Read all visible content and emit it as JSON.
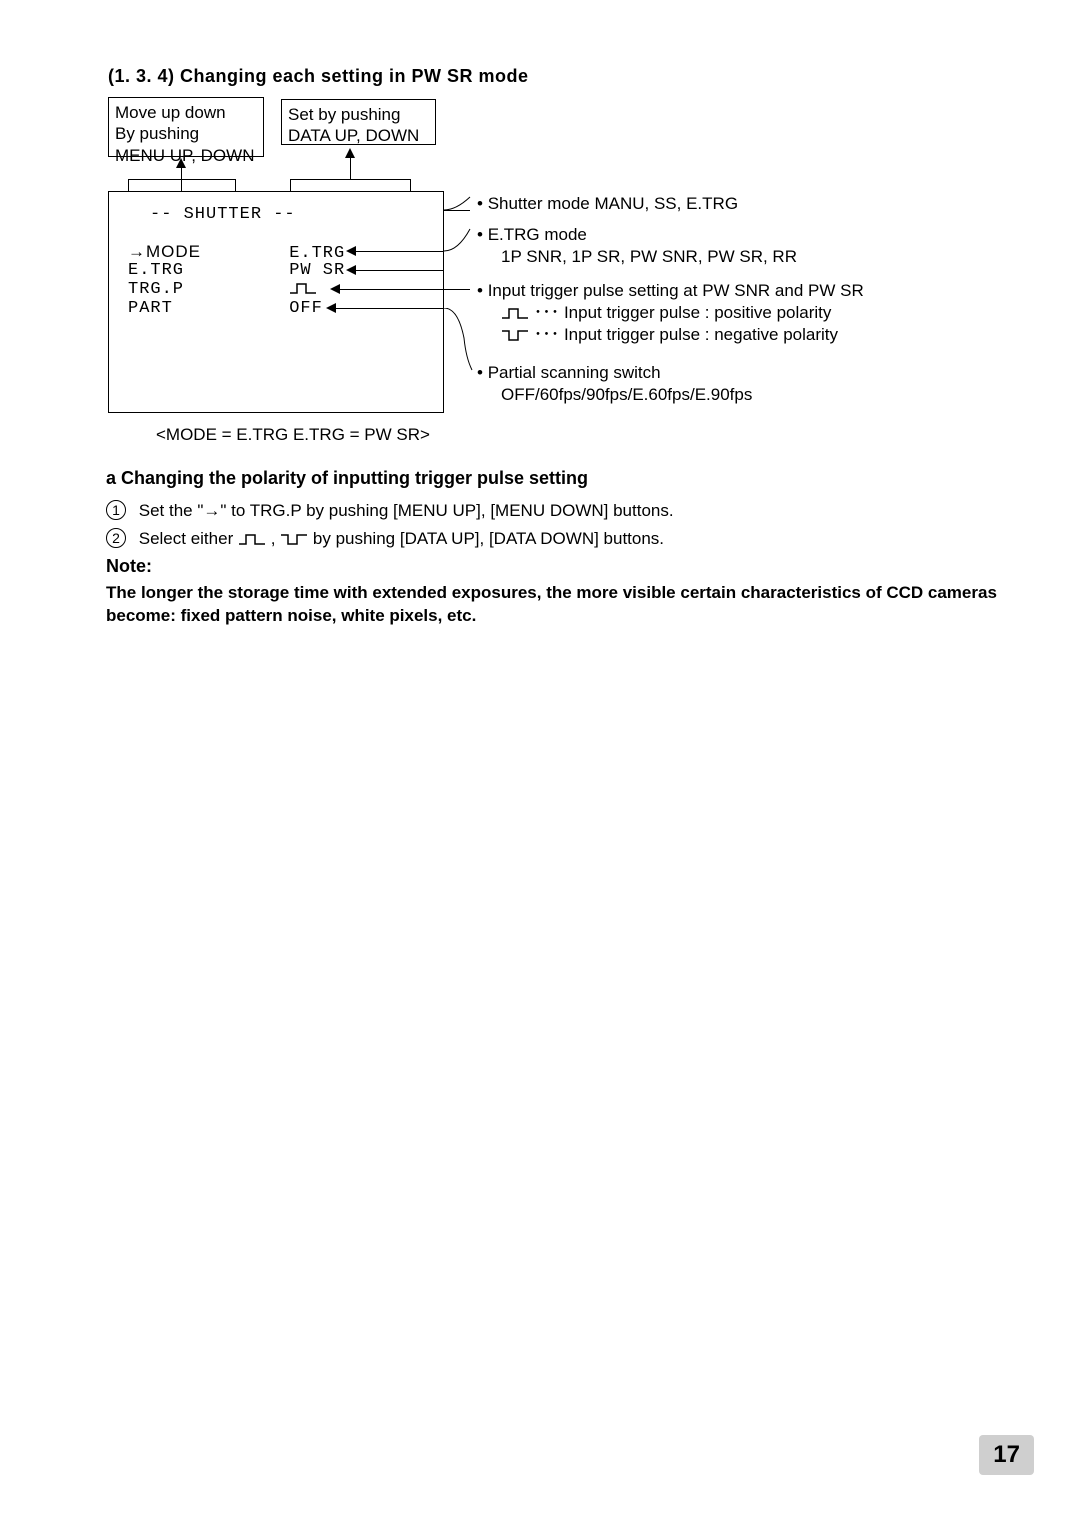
{
  "heading": "(1. 3. 4)   Changing each setting in PW SR mode",
  "box1": {
    "line1": "Move up down",
    "line2": "By pushing",
    "line3": "MENU UP, DOWN"
  },
  "box2": {
    "line1": "Set by pushing",
    "line2": "DATA UP, DOWN"
  },
  "lcd": {
    "title": "-- SHUTTER --",
    "rows": [
      {
        "label": "→MODE",
        "value": "E.TRG"
      },
      {
        "label": " E.TRG",
        "value": "PW SR"
      },
      {
        "label": " TRG.P",
        "value": ""
      },
      {
        "label": " PART",
        "value": "OFF"
      }
    ]
  },
  "desc": {
    "d1": {
      "head": "Shutter mode   MANU, SS, E.TRG"
    },
    "d2": {
      "head": "E.TRG mode",
      "sub1": "1P SNR, 1P SR, PW SNR, PW SR, RR"
    },
    "d3": {
      "head": "Input trigger pulse setting at PW SNR and PW SR",
      "sub1": " ･･･ Input trigger pulse : positive polarity",
      "sub2": " ･･･ Input trigger pulse : negative polarity"
    },
    "d4": {
      "head": "Partial scanning switch",
      "sub1": "OFF/60fps/90fps/E.60fps/E.90fps"
    }
  },
  "caption": "<MODE = E.TRG   E.TRG = PW SR>",
  "subheading": "a   Changing the polarity of inputting trigger pulse setting",
  "steps": {
    "s1_num": "1",
    "s1": "Set the \"→\" to TRG.P by pushing [MENU UP], [MENU DOWN] buttons.",
    "s2_num": "2",
    "s2_before": "Select either",
    "s2_mid": " , ",
    "s2_after": " by pushing [DATA UP], [DATA DOWN] buttons."
  },
  "note_label": "Note:",
  "note_body": "The longer the storage time with extended exposures, the more visible certain characteristics of CCD cameras become: fixed pattern noise, white pixels, etc.",
  "page_number": "17"
}
